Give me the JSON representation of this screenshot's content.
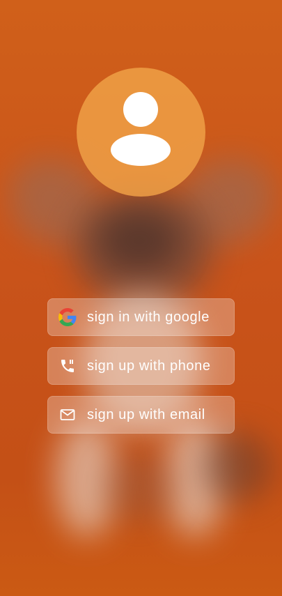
{
  "colors": {
    "background": "#cf5514",
    "avatar_bg": "#eea046",
    "button_bg": "rgba(255,255,255,0.28)",
    "text": "#ffffff"
  },
  "avatar": {
    "icon": "person-icon"
  },
  "buttons": {
    "google": {
      "label": "sign in with google",
      "icon": "google-icon"
    },
    "phone": {
      "label": "sign up with phone",
      "icon": "phone-icon"
    },
    "email": {
      "label": "sign up with email",
      "icon": "mail-icon"
    }
  }
}
